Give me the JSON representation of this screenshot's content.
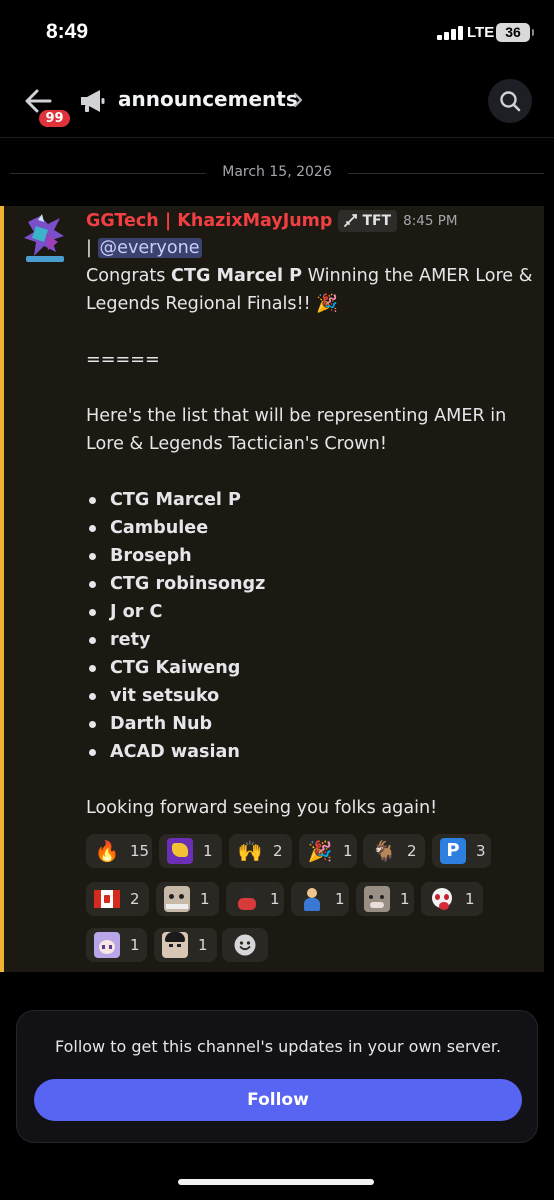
{
  "status_bar": {
    "time": "8:49",
    "network": "LTE",
    "battery": "36"
  },
  "header": {
    "back_icon": "arrow-left-icon",
    "unread_badge": "99",
    "channel_icon": "megaphone-icon",
    "channel_name": "announcements",
    "search_icon": "search-icon"
  },
  "divider": {
    "date": "March 15, 2026"
  },
  "message": {
    "author": "GGTech | KhazixMayJump",
    "role_tag": "TFT",
    "timestamp": "8:45 PM",
    "line_prefix": "| ",
    "mention": "@everyone",
    "congrats_pre": "Congrats ",
    "congrats_name": "CTG Marcel P",
    "congrats_post": " Winning the AMER Lore & Legends Regional Finals!! 🎉",
    "separator": "=====",
    "list_intro": "Here's the list that will be representing AMER in Lore & Legends Tactician's Crown!",
    "players": [
      "CTG Marcel P",
      "Cambulee",
      "Broseph",
      "CTG robinsongz",
      "J or C",
      "rety",
      "CTG Kaiweng",
      "vit setsuko",
      "Darth Nub",
      "ACAD wasian"
    ],
    "closing": "Looking forward seeing you folks again!"
  },
  "reactions": [
    {
      "emoji": "fire",
      "glyph": "🔥",
      "count": "15"
    },
    {
      "emoji": "custom-purple",
      "glyph": "",
      "count": "1"
    },
    {
      "emoji": "raised-hands",
      "glyph": "🙌",
      "count": "2"
    },
    {
      "emoji": "party-popper",
      "glyph": "🎉",
      "count": "1"
    },
    {
      "emoji": "goat",
      "glyph": "🐐",
      "count": "2"
    },
    {
      "emoji": "p-button",
      "glyph": "🅿️",
      "count": "3"
    },
    {
      "emoji": "flag-canada",
      "glyph": "🇨🇦",
      "count": "2"
    },
    {
      "emoji": "custom-face",
      "glyph": "",
      "count": "1"
    },
    {
      "emoji": "custom-fighter",
      "glyph": "",
      "count": "1"
    },
    {
      "emoji": "person-blue",
      "glyph": "",
      "count": "1"
    },
    {
      "emoji": "custom-cat",
      "glyph": "",
      "count": "1"
    },
    {
      "emoji": "custom-mask",
      "glyph": "",
      "count": "1"
    },
    {
      "emoji": "custom-anime",
      "glyph": "",
      "count": "1"
    },
    {
      "emoji": "custom-person",
      "glyph": "",
      "count": "1"
    }
  ],
  "add_reaction_icon": "smiley-add-icon",
  "follow": {
    "text": "Follow to get this channel's updates in your own server.",
    "button": "Follow"
  }
}
